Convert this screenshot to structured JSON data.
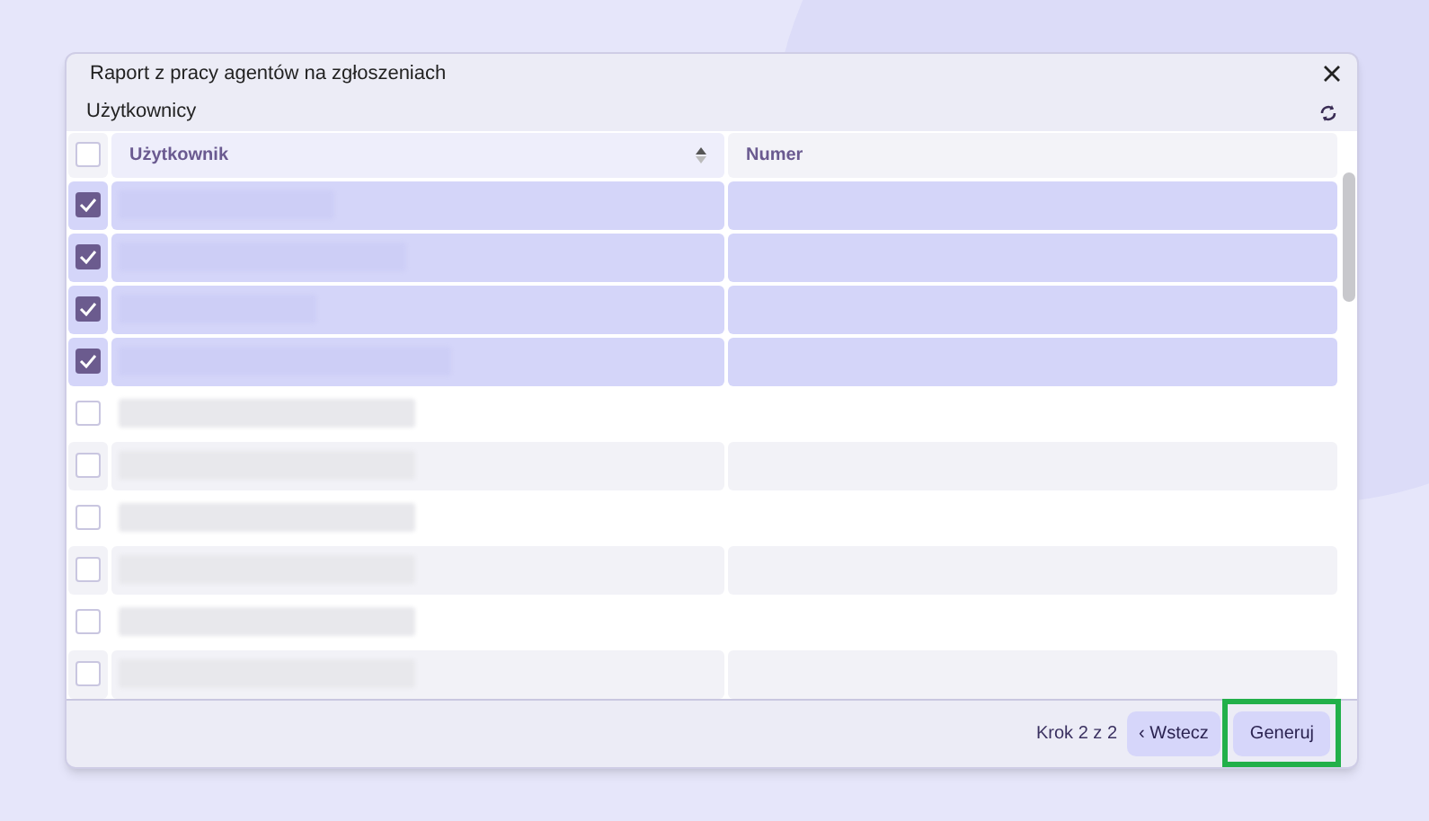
{
  "dialog": {
    "title": "Raport z pracy agentów na zgłoszeniach",
    "section": "Użytkownicy"
  },
  "table": {
    "columns": [
      {
        "label": "Użytkownik",
        "sortable": true
      },
      {
        "label": "Numer",
        "sortable": false
      }
    ],
    "select_all_checked": false,
    "rows": [
      {
        "checked": true
      },
      {
        "checked": true
      },
      {
        "checked": true
      },
      {
        "checked": true
      },
      {
        "checked": false
      },
      {
        "checked": false
      },
      {
        "checked": false
      },
      {
        "checked": false
      },
      {
        "checked": false
      },
      {
        "checked": false
      }
    ]
  },
  "footer": {
    "step": "Krok 2 z 2",
    "back_button": "‹ Wstecz",
    "generate_button": "Generuj",
    "generate_highlighted": true
  }
}
